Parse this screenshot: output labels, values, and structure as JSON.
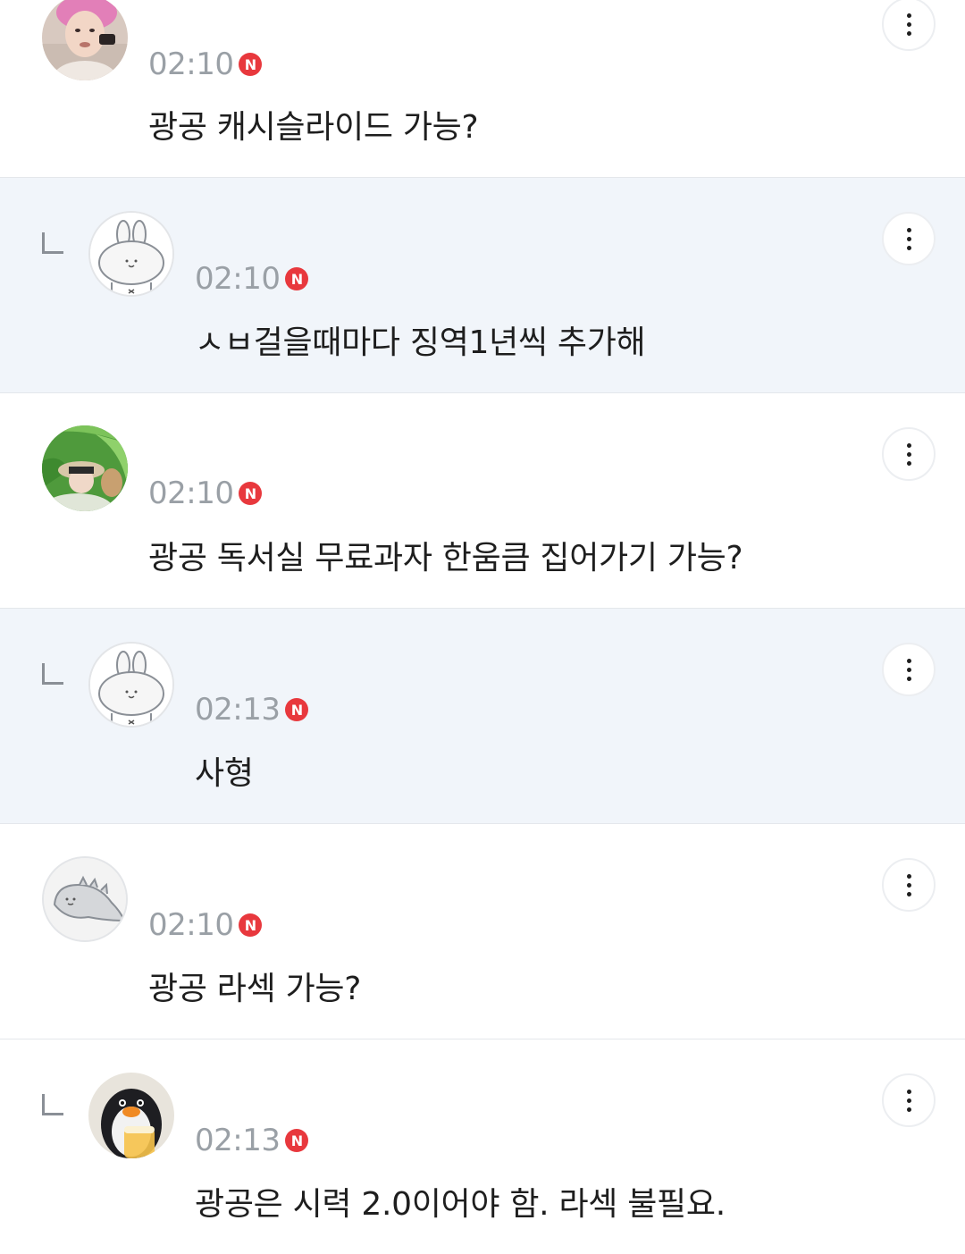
{
  "accent": {
    "new_badge_color": "#e8383d",
    "reply_background": "#f1f5fa",
    "timestamp_color": "#9aa0a6"
  },
  "comments": [
    {
      "is_reply": false,
      "avatar": "photo-avatar-pink-hair",
      "time": "02:10",
      "badge": "N",
      "text": "광공 캐시슬라이드 가능?"
    },
    {
      "is_reply": true,
      "avatar": "bunny-default-avatar",
      "time": "02:10",
      "badge": "N",
      "text": "ㅅㅂ걸을때마다 징역1년씩 추가해"
    },
    {
      "is_reply": false,
      "avatar": "photo-avatar-leaves",
      "time": "02:10",
      "badge": "N",
      "text": "광공 독서실 무료과자 한움큼 집어가기 가능?"
    },
    {
      "is_reply": true,
      "avatar": "bunny-default-avatar",
      "time": "02:13",
      "badge": "N",
      "text": "사형"
    },
    {
      "is_reply": false,
      "avatar": "dinosaur-default-avatar",
      "time": "02:10",
      "badge": "N",
      "text": "광공 라섹 가능?"
    },
    {
      "is_reply": true,
      "avatar": "photo-avatar-penguin",
      "time": "02:13",
      "badge": "N",
      "text": "광공은 시력 2.0이어야 함. 라섹 불필요."
    }
  ],
  "icons": {
    "more": "vertical-ellipsis-icon",
    "reply": "reply-corner-icon"
  }
}
